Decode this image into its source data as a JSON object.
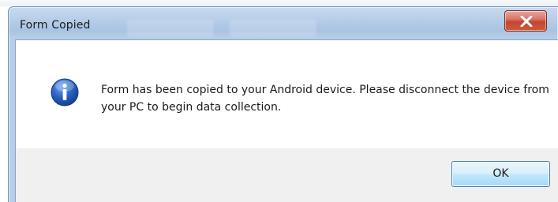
{
  "dialog": {
    "title": "Form Copied",
    "message": "Form has been copied to your Android device. Please disconnect the device from your PC to begin data collection.",
    "ok_label": "OK",
    "icon": "info-icon",
    "close_icon": "close-icon"
  },
  "colors": {
    "titlebar": "#b9cfe9",
    "close_button": "#c24632",
    "info_icon": "#1f5fb8",
    "ok_button_border": "#3c7fb1",
    "footer_background": "#f0f0f0"
  }
}
